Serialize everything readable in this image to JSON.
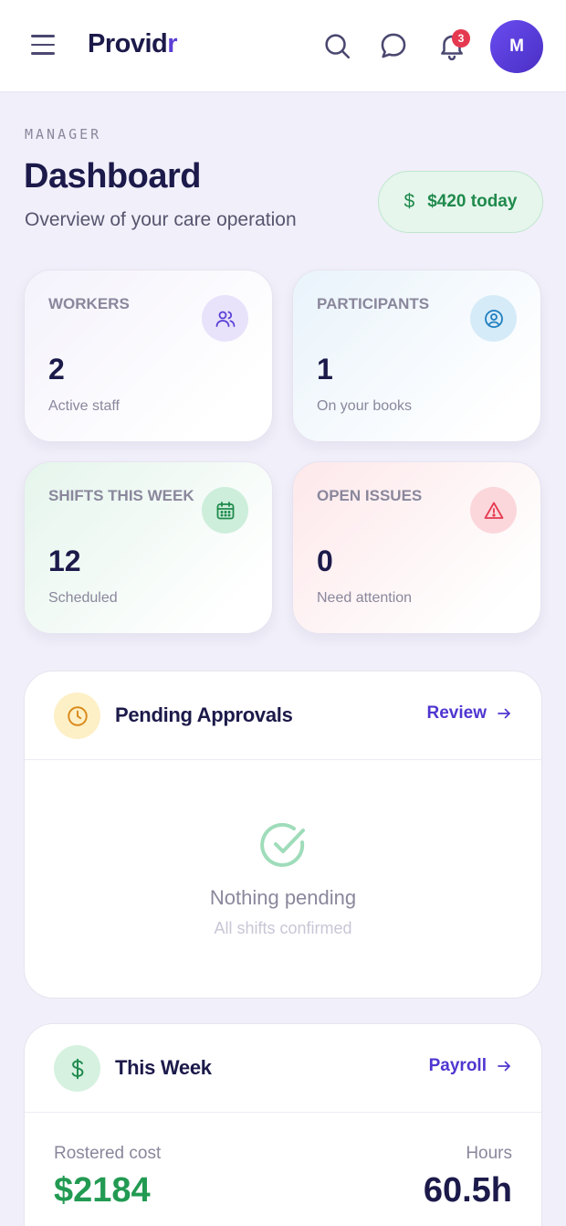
{
  "app": {
    "logo_main": "Provid",
    "logo_accent": "r",
    "notification_count": "3",
    "avatar_initial": "M"
  },
  "header": {
    "role": "MANAGER",
    "title": "Dashboard",
    "subtitle": "Overview of your care operation",
    "today_amount": "$420 today"
  },
  "stats": {
    "workers": {
      "label": "WORKERS",
      "value": "2",
      "sub": "Active staff",
      "icon": "users-icon"
    },
    "participants": {
      "label": "PARTICIPANTS",
      "value": "1",
      "sub": "On your books",
      "icon": "user-circle-icon"
    },
    "shifts": {
      "label": "SHIFTS THIS WEEK",
      "value": "12",
      "sub": "Scheduled",
      "icon": "calendar-icon"
    },
    "issues": {
      "label": "OPEN ISSUES",
      "value": "0",
      "sub": "Need attention",
      "icon": "warning-icon"
    }
  },
  "pending": {
    "title": "Pending Approvals",
    "link": "Review",
    "empty_title": "Nothing pending",
    "empty_sub": "All shifts confirmed"
  },
  "week": {
    "title": "This Week",
    "link": "Payroll",
    "cost_label": "Rostered cost",
    "cost_value": "$2184",
    "hours_label": "Hours",
    "hours_value": "60.5h"
  },
  "colors": {
    "accent": "#5036d0",
    "success": "#229a52",
    "danger": "#e53950",
    "background": "#f1eff9"
  }
}
